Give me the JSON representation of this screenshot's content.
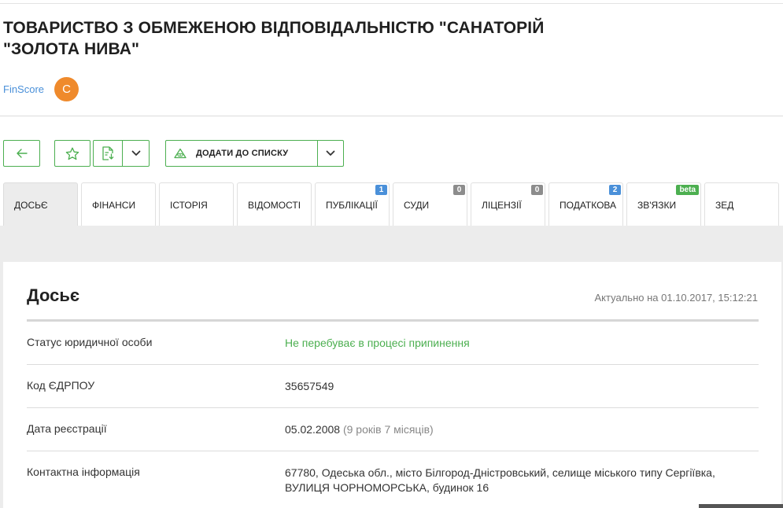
{
  "company": {
    "title": "ТОВАРИСТВО З ОБМЕЖЕНОЮ ВІДПОВІДАЛЬНІСТЮ \"САНАТОРІЙ \"ЗОЛОТА НИВА\"",
    "finscore_label": "FinScore",
    "finscore_grade": "C"
  },
  "toolbar": {
    "back_icon": "arrow-left-icon",
    "favorite_icon": "star-icon",
    "document_icon": "document-download-icon",
    "add_to_list_icon": "triangle-eye-icon",
    "add_to_list_label": "ДОДАТИ ДО СПИСКУ",
    "accent_color": "#4caf50"
  },
  "tabs": [
    {
      "label": "ДОСЬЄ",
      "active": true,
      "badge": ""
    },
    {
      "label": "ФІНАНСИ",
      "badge": ""
    },
    {
      "label": "ІСТОРІЯ",
      "badge": ""
    },
    {
      "label": "ВІДОМОСТІ",
      "badge": ""
    },
    {
      "label": "ПУБЛІКАЦІЇ",
      "badge": "1",
      "badge_color": "#4a90d9"
    },
    {
      "label": "СУДИ",
      "badge": "0",
      "badge_color": "#8c8c8c"
    },
    {
      "label": "ЛІЦЕНЗІЇ",
      "badge": "0",
      "badge_color": "#8c8c8c"
    },
    {
      "label": "ПОДАТКОВА",
      "badge": "2",
      "badge_color": "#4a90d9"
    },
    {
      "label": "ЗВ'ЯЗКИ",
      "badge": "beta",
      "badge_color": "#4caf50"
    },
    {
      "label": "ЗЕД",
      "badge": ""
    }
  ],
  "dossier": {
    "title": "Досьє",
    "updated": "Актуально на 01.10.2017, 15:12:21",
    "rows": [
      {
        "key": "Статус юридичної особи",
        "value": "Не перебуває в процесі припинення",
        "status_color": "#4caf50"
      },
      {
        "key": "Код ЄДРПОУ",
        "value": "35657549"
      },
      {
        "key": "Дата реєстрації",
        "value": "05.02.2008",
        "note": "(9 років 7 місяців)"
      },
      {
        "key": "Контактна інформація",
        "value": "67780, Одеська обл., місто Білгород-Дністровський, селище міського типу Сергіївка,",
        "value_line2": "ВУЛИЦЯ ЧОРНОМОРСЬКА, будинок 16"
      }
    ]
  }
}
